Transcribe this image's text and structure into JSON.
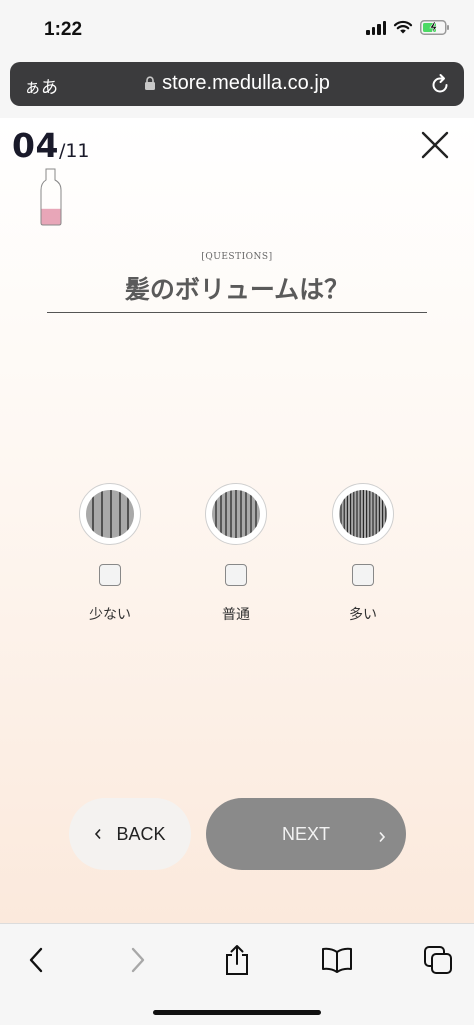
{
  "status_bar": {
    "time": "1:22",
    "battery_color": "#4cd964"
  },
  "browser": {
    "aa_label": "ぁあ",
    "url": "store.medulla.co.jp"
  },
  "progress": {
    "current": "04",
    "total": "/11",
    "fraction": 0.36
  },
  "question": {
    "tag": "[QUESTIONS]",
    "title": "髪のボリュームは？"
  },
  "options": [
    {
      "label": "少ない",
      "icon": "sparse-hair-icon",
      "checked": false
    },
    {
      "label": "普通",
      "icon": "normal-hair-icon",
      "checked": false
    },
    {
      "label": "多い",
      "icon": "thick-hair-icon",
      "checked": false
    }
  ],
  "navigation": {
    "back_label": "BACK",
    "next_label": "NEXT"
  },
  "colors": {
    "accent_pink": "#e8a6b8",
    "next_disabled": "#8a8a8a"
  }
}
